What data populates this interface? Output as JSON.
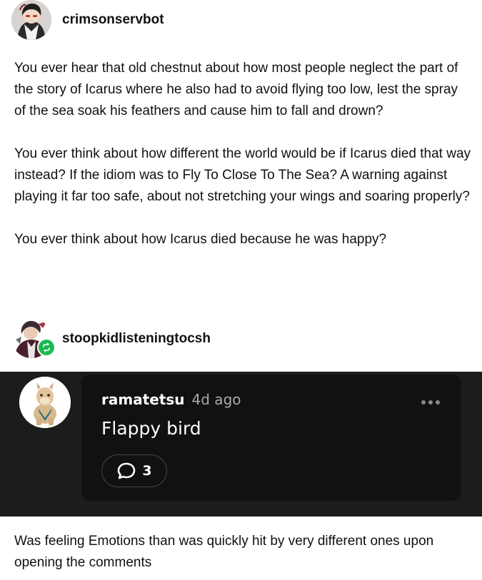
{
  "post1": {
    "username": "crimsonservbot",
    "avatar_icon": "anime-character-avatar-icon",
    "paragraphs": [
      "You ever hear that old chestnut about how most people neglect the part of the story of Icarus where he also had to avoid flying too low, lest the spray of the sea soak his feathers and cause him to fall and drown?",
      "You ever think about how different the world would be if Icarus died that way instead? If the idiom was to Fly To Close To The Sea? A warning against playing it far too safe, about not stretching your wings and soaring properly?",
      "You ever think about how Icarus died because he was happy?"
    ]
  },
  "post2": {
    "username": "stoopkidlisteningtocsh",
    "avatar_icon": "anime-character-avatar-icon",
    "badge_icon": "reblog-icon",
    "badge_color": "#1db954"
  },
  "comment": {
    "author": "ramatetsu",
    "time": "4d ago",
    "body": "Flappy bird",
    "reply_count": "3",
    "avatar_icon": "alpaca-avatar-icon",
    "reply_icon": "speech-bubble-icon",
    "more_icon": "more-options-icon",
    "panel_color": "#1c1c1c",
    "card_color": "#111111"
  },
  "post2_text": "Was feeling Emotions than was quickly hit by very different ones upon opening the comments"
}
